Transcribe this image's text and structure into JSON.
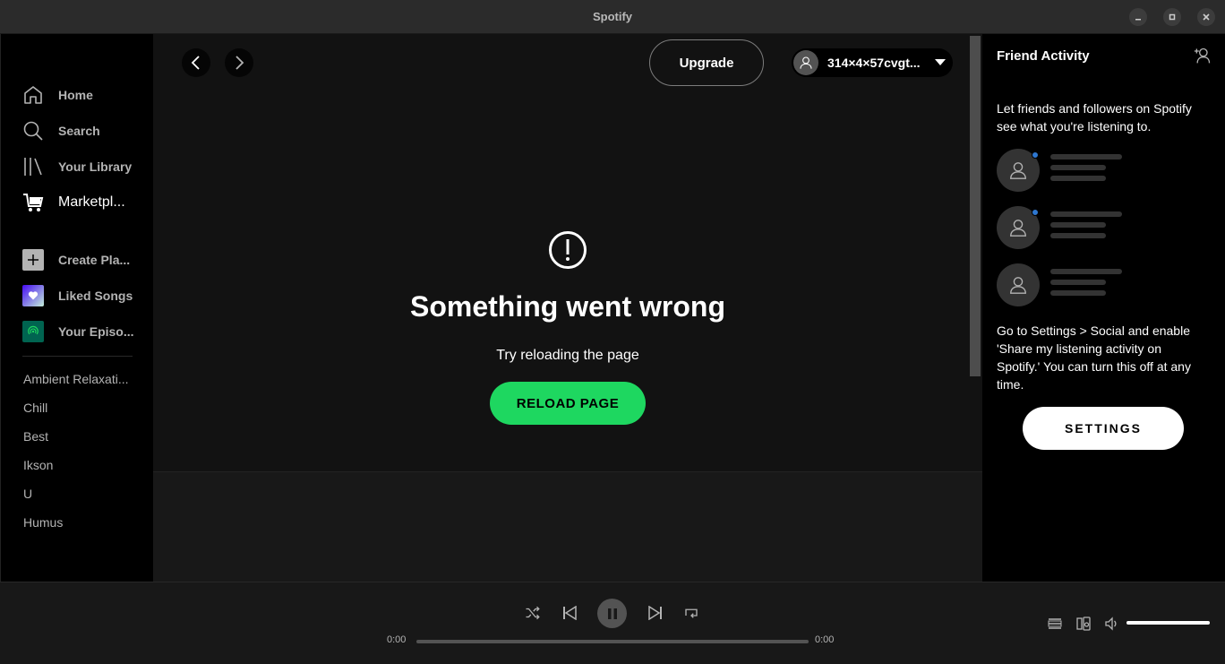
{
  "window": {
    "title": "Spotify"
  },
  "sidebar": {
    "nav": [
      {
        "label": "Home",
        "icon": "home-icon"
      },
      {
        "label": "Search",
        "icon": "search-icon"
      },
      {
        "label": "Your Library",
        "icon": "library-icon"
      },
      {
        "label": "Marketpl...",
        "icon": "cart-icon"
      }
    ],
    "actions": [
      {
        "label": "Create Pla...",
        "icon": "plus-icon"
      },
      {
        "label": "Liked Songs",
        "icon": "heart-icon"
      },
      {
        "label": "Your Episo...",
        "icon": "podcast-icon"
      }
    ],
    "playlists": [
      "Ambient Relaxati...",
      "Chill",
      "Best",
      "Ikson",
      "U",
      "Humus"
    ]
  },
  "topbar": {
    "upgrade_label": "Upgrade",
    "username": "314×4×57cvgt..."
  },
  "error": {
    "title": "Something went wrong",
    "subtitle": "Try reloading the page",
    "reload_label": "RELOAD PAGE"
  },
  "friends": {
    "title": "Friend Activity",
    "intro": "Let friends and followers on Spotify see what you're listening to.",
    "note": "Go to Settings > Social and enable 'Share my listening activity on Spotify.' You can turn this off at any time.",
    "settings_label": "SETTINGS"
  },
  "player": {
    "elapsed": "0:00",
    "duration": "0:00",
    "volume": 1.0,
    "progress": 0
  },
  "colors": {
    "accent": "#1ed760",
    "online_dot": "#2e77d0"
  }
}
